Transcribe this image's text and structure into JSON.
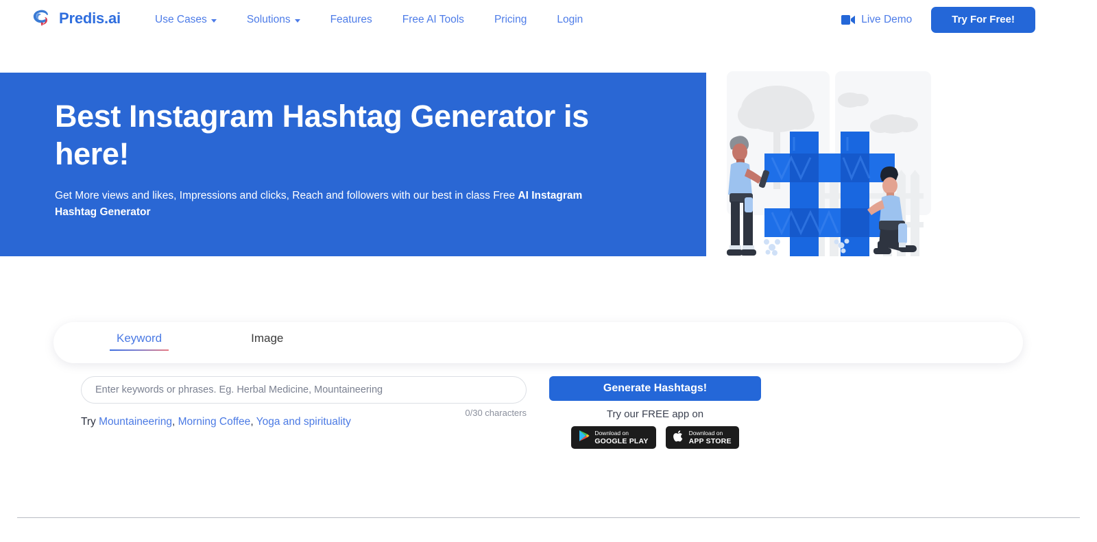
{
  "brand": {
    "name": "Predis.ai",
    "logo_icon": "speech-bubble-swirl-logo",
    "accent_blue": "#2467d8",
    "accent_red": "#e05a63"
  },
  "header": {
    "nav": [
      {
        "label": "Use Cases",
        "has_dropdown": true
      },
      {
        "label": "Solutions",
        "has_dropdown": true
      },
      {
        "label": "Features",
        "has_dropdown": false
      },
      {
        "label": "Free AI Tools",
        "has_dropdown": false
      },
      {
        "label": "Pricing",
        "has_dropdown": false
      },
      {
        "label": "Login",
        "has_dropdown": false
      }
    ],
    "live_demo": {
      "label": "Live Demo",
      "icon": "video-camera-icon"
    },
    "cta": {
      "label": "Try For Free!"
    }
  },
  "hero": {
    "title": "Best Instagram Hashtag Generator is here!",
    "subtitle_plain": "Get More views and likes, Impressions and clicks, Reach and followers with our best in class Free ",
    "subtitle_bold": "AI Instagram Hashtag Generator",
    "background_color": "#2a67d4",
    "illustration": "two-people-building-hashtag-illustration"
  },
  "generator": {
    "tabs": [
      {
        "label": "Keyword",
        "active": true
      },
      {
        "label": "Image",
        "active": false
      }
    ],
    "input": {
      "value": "",
      "placeholder": "Enter keywords or phrases. Eg. Herbal Medicine, Mountaineering"
    },
    "char_counter": "0/30 characters",
    "try_prefix": "Try",
    "suggestions": [
      {
        "label": "Mountaineering"
      },
      {
        "label": "Morning Coffee"
      },
      {
        "label": "Yoga and spirituality"
      }
    ],
    "generate_button": "Generate Hashtags!",
    "app_promo_label": "Try our FREE app on",
    "badges": [
      {
        "icon": "google-play-icon",
        "small": "Download on",
        "big": "GOOGLE PLAY"
      },
      {
        "icon": "apple-icon",
        "small": "Download on",
        "big": "APP STORE"
      }
    ]
  }
}
